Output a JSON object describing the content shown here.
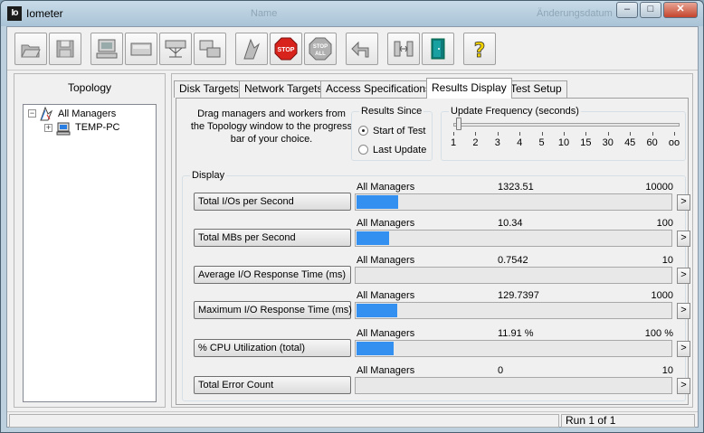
{
  "window": {
    "title": "Iometer",
    "app_icon_text": "Io",
    "background_titles": [
      "Name",
      "Änderungsdatum"
    ],
    "controls": {
      "minimize": "–",
      "maximize": "□",
      "close": "✕"
    }
  },
  "toolbar": {
    "buttons": [
      {
        "icon": "open-folder-icon"
      },
      {
        "icon": "save-disk-icon"
      },
      {
        "icon": "new-manager-computer-icon"
      },
      {
        "icon": "new-disk-worker-icon"
      },
      {
        "icon": "new-network-worker-icon"
      },
      {
        "icon": "duplicate-worker-icon"
      },
      {
        "icon": "start-test-flag-icon"
      },
      {
        "icon": "stop-icon",
        "label": "STOP"
      },
      {
        "icon": "stop-all-icon",
        "label": "STOP ALL"
      },
      {
        "icon": "reset-workers-arrow-icon"
      },
      {
        "icon": "disconnect-icon"
      },
      {
        "icon": "exit-door-icon"
      },
      {
        "icon": "help-icon",
        "label": "?"
      }
    ]
  },
  "topology": {
    "title": "Topology",
    "root": {
      "label": "All Managers",
      "expander": "−"
    },
    "child": {
      "label": "TEMP-PC",
      "expander": "+"
    }
  },
  "tabs": [
    {
      "label": "Disk Targets",
      "active": false
    },
    {
      "label": "Network Targets",
      "active": false
    },
    {
      "label": "Access Specifications",
      "active": false
    },
    {
      "label": "Results Display",
      "active": true
    },
    {
      "label": "Test Setup",
      "active": false
    }
  ],
  "results_display": {
    "instructions": "Drag managers and workers from the Topology window to the progress bar of your choice.",
    "results_since": {
      "title": "Results Since",
      "options": [
        {
          "label": "Start of Test",
          "selected": true
        },
        {
          "label": "Last Update",
          "selected": false
        }
      ]
    },
    "update_frequency": {
      "title": "Update Frequency (seconds)",
      "ticks": [
        "1",
        "2",
        "3",
        "4",
        "5",
        "10",
        "15",
        "30",
        "45",
        "60",
        "oo"
      ],
      "selected_index": 0
    },
    "display": {
      "title": "Display",
      "rows": [
        {
          "button": "Total I/Os per Second",
          "source": "All Managers",
          "value": "1323.51",
          "max": "10000",
          "fill_fraction": 0.1324,
          "arrow": ">"
        },
        {
          "button": "Total MBs per Second",
          "source": "All Managers",
          "value": "10.34",
          "max": "100",
          "fill_fraction": 0.1034,
          "arrow": ">"
        },
        {
          "button": "Average I/O Response Time (ms)",
          "source": "All Managers",
          "value": "0.7542",
          "max": "10",
          "fill_fraction": 0.0,
          "arrow": ">"
        },
        {
          "button": "Maximum I/O Response Time (ms)",
          "source": "All Managers",
          "value": "129.7397",
          "max": "1000",
          "fill_fraction": 0.1297,
          "arrow": ">"
        },
        {
          "button": "% CPU Utilization (total)",
          "source": "All Managers",
          "value": "11.91 %",
          "max": "100 %",
          "fill_fraction": 0.1191,
          "arrow": ">"
        },
        {
          "button": "Total Error Count",
          "source": "All Managers",
          "value": "0",
          "max": "10",
          "fill_fraction": 0.0,
          "arrow": ">"
        }
      ]
    }
  },
  "statusbar": {
    "run": "Run 1 of 1"
  },
  "colors": {
    "bar_fill": "#3390f0",
    "stop_red": "#d8231c",
    "help_yellow": "#f0d000"
  }
}
